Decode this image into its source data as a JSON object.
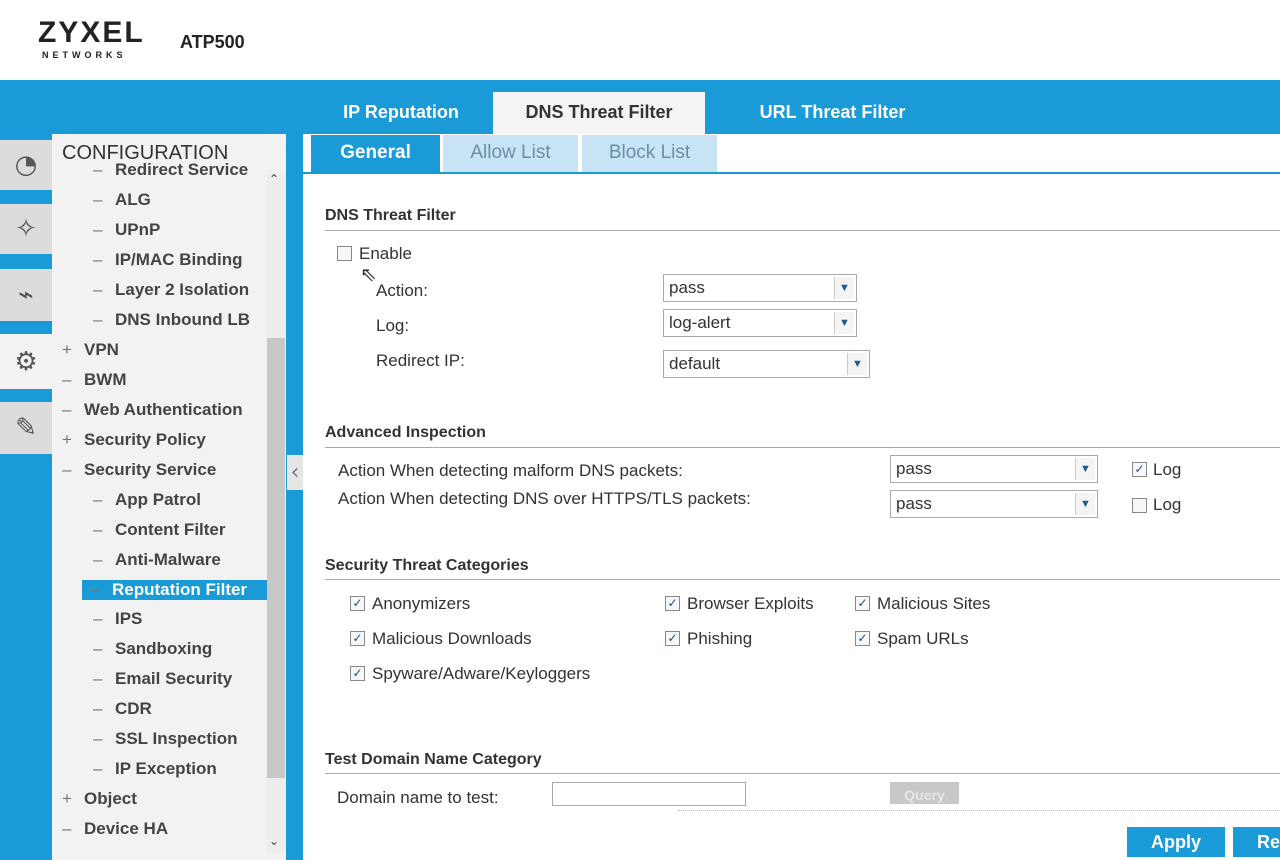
{
  "header": {
    "brand": "ZYXEL",
    "brand_sub": "NETWORKS",
    "model": "ATP500"
  },
  "tabs": [
    {
      "label": "IP Reputation"
    },
    {
      "label": "DNS Threat Filter"
    },
    {
      "label": "URL Threat Filter"
    }
  ],
  "subtabs": [
    {
      "label": "General"
    },
    {
      "label": "Allow List"
    },
    {
      "label": "Block List"
    }
  ],
  "rail": [
    {
      "icon": "dashboard-icon"
    },
    {
      "icon": "wizard-icon"
    },
    {
      "icon": "monitor-icon"
    },
    {
      "icon": "gear-icon"
    },
    {
      "icon": "maintenance-icon"
    }
  ],
  "sidebar": {
    "title": "CONFIGURATION",
    "items": [
      {
        "label": "Redirect Service",
        "level": 2,
        "prefix": "–"
      },
      {
        "label": "ALG",
        "level": 2,
        "prefix": "–"
      },
      {
        "label": "UPnP",
        "level": 2,
        "prefix": "–"
      },
      {
        "label": "IP/MAC Binding",
        "level": 2,
        "prefix": "–"
      },
      {
        "label": "Layer 2 Isolation",
        "level": 2,
        "prefix": "–"
      },
      {
        "label": "DNS Inbound LB",
        "level": 2,
        "prefix": "–"
      },
      {
        "label": "VPN",
        "level": 1,
        "prefix": "+"
      },
      {
        "label": "BWM",
        "level": 1,
        "prefix": "–"
      },
      {
        "label": "Web Authentication",
        "level": 1,
        "prefix": "–"
      },
      {
        "label": "Security Policy",
        "level": 1,
        "prefix": "+"
      },
      {
        "label": "Security Service",
        "level": 1,
        "prefix": "–"
      },
      {
        "label": "App Patrol",
        "level": 2,
        "prefix": "–"
      },
      {
        "label": "Content Filter",
        "level": 2,
        "prefix": "–"
      },
      {
        "label": "Anti-Malware",
        "level": 2,
        "prefix": "–"
      },
      {
        "label": "Reputation Filter",
        "level": 2,
        "prefix": "–",
        "selected": true
      },
      {
        "label": "IPS",
        "level": 2,
        "prefix": "–"
      },
      {
        "label": "Sandboxing",
        "level": 2,
        "prefix": "–"
      },
      {
        "label": "Email Security",
        "level": 2,
        "prefix": "–"
      },
      {
        "label": "CDR",
        "level": 2,
        "prefix": "–"
      },
      {
        "label": "SSL Inspection",
        "level": 2,
        "prefix": "–"
      },
      {
        "label": "IP Exception",
        "level": 2,
        "prefix": "–"
      },
      {
        "label": "Object",
        "level": 1,
        "prefix": "+"
      },
      {
        "label": "Device HA",
        "level": 1,
        "prefix": "–"
      }
    ]
  },
  "dns": {
    "title": "DNS Threat Filter",
    "enable_label": "Enable",
    "enabled": false,
    "action_label": "Action:",
    "action": "pass",
    "log_label": "Log:",
    "log": "log-alert",
    "redirect_label": "Redirect IP:",
    "redirect": "default"
  },
  "advanced": {
    "title": "Advanced Inspection",
    "malform_label": "Action When detecting malform DNS packets:",
    "malform": "pass",
    "malform_log": true,
    "doh_label": "Action When detecting DNS over HTTPS/TLS packets:",
    "doh": "pass",
    "doh_log": false,
    "log_label": "Log"
  },
  "categories": {
    "title": "Security Threat Categories",
    "items": [
      {
        "label": "Anonymizers",
        "checked": true
      },
      {
        "label": "Browser Exploits",
        "checked": true
      },
      {
        "label": "Malicious Sites",
        "checked": true
      },
      {
        "label": "Malicious Downloads",
        "checked": true
      },
      {
        "label": "Phishing",
        "checked": true
      },
      {
        "label": "Spam URLs",
        "checked": true
      },
      {
        "label": "Spyware/Adware/Keyloggers",
        "checked": true
      }
    ]
  },
  "test": {
    "title": "Test Domain Name Category",
    "domain_label": "Domain name to test:",
    "domain_value": "",
    "query_label": "Query"
  },
  "footer": {
    "apply": "Apply",
    "reset": "Reset"
  }
}
